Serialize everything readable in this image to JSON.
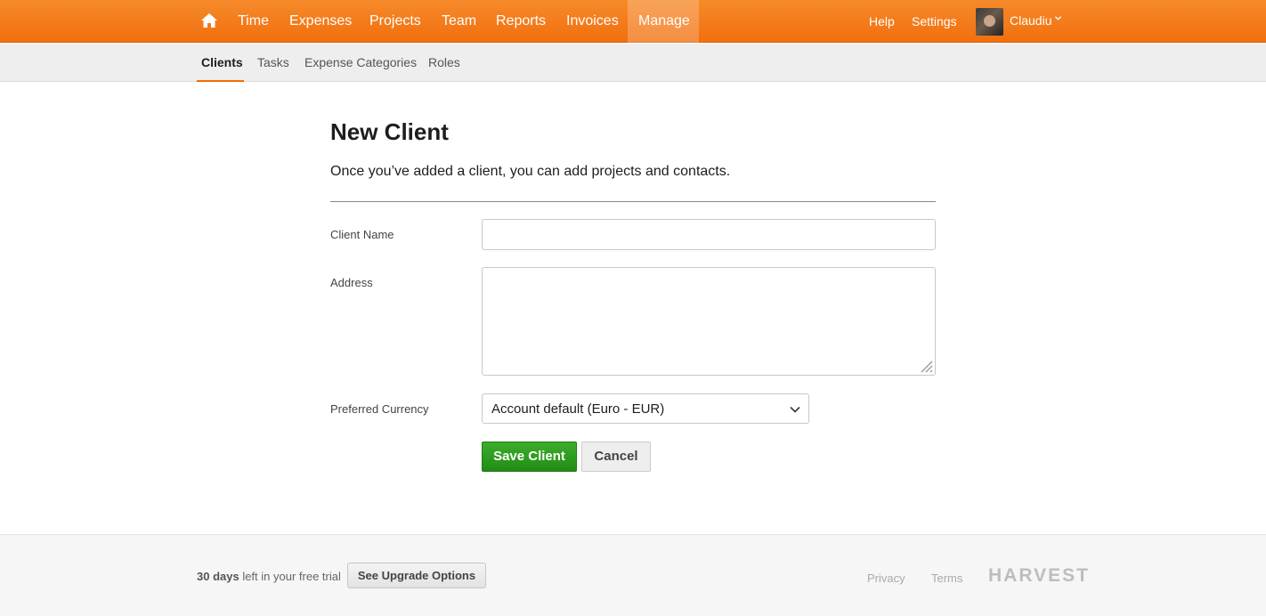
{
  "nav": {
    "items": [
      "Time",
      "Expenses",
      "Projects",
      "Team",
      "Reports",
      "Invoices",
      "Manage"
    ],
    "active": "Manage",
    "help": "Help",
    "settings": "Settings",
    "user_name": "Claudiu",
    "accent_color": "#f36c00"
  },
  "subnav": {
    "items": [
      "Clients",
      "Tasks",
      "Expense Categories",
      "Roles"
    ],
    "active": "Clients"
  },
  "form": {
    "title": "New Client",
    "intro": "Once you’ve added a client, you can add projects and contacts.",
    "client_name_label": "Client Name",
    "client_name_value": "",
    "address_label": "Address",
    "address_value": "",
    "currency_label": "Preferred Currency",
    "currency_value": "Account default (Euro - EUR)",
    "save_label": "Save Client",
    "cancel_label": "Cancel",
    "save_color": "#2e9e22"
  },
  "footer": {
    "trial_days": "30 days",
    "trial_rest": "left in your free trial",
    "upgrade_label": "See Upgrade Options",
    "privacy": "Privacy",
    "terms": "Terms",
    "logo_text": "HARVEST"
  }
}
